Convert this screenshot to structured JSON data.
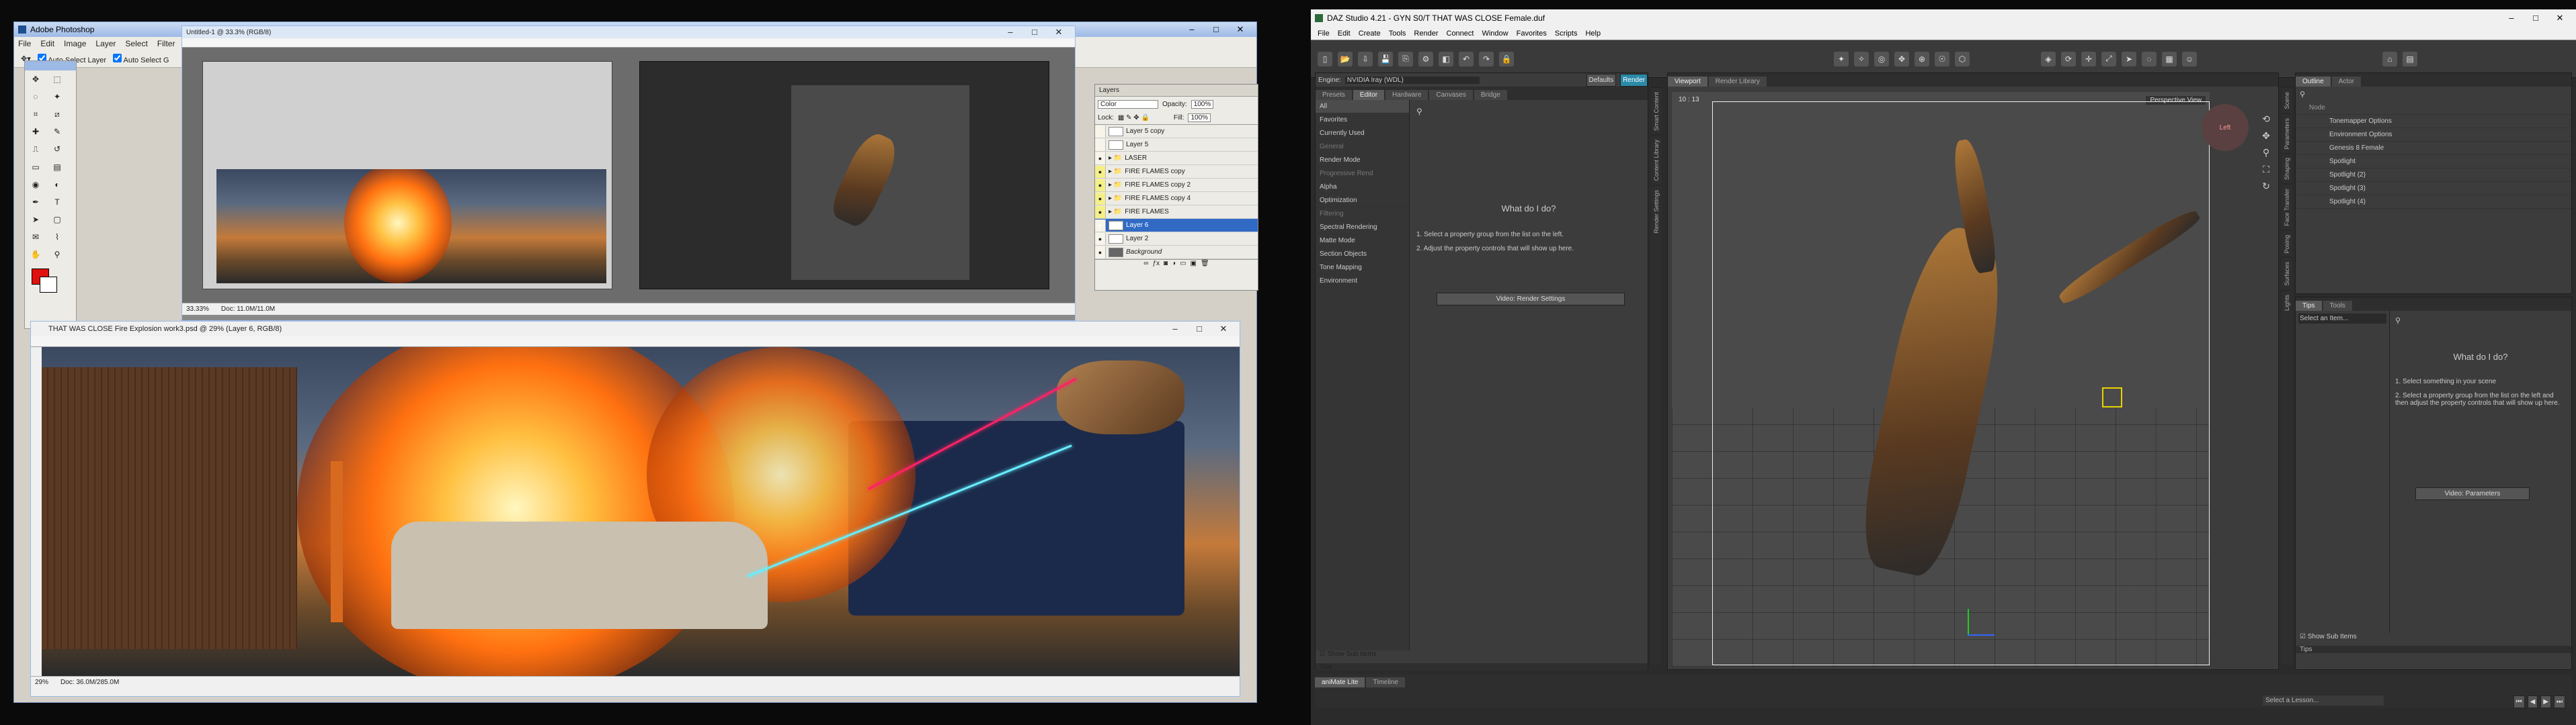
{
  "photoshop": {
    "title": "Adobe Photoshop",
    "menu": [
      "File",
      "Edit",
      "Image",
      "Layer",
      "Select",
      "Filter"
    ],
    "options": {
      "auto_select_layer": "Auto Select Layer",
      "auto_select_2": "Auto Select G"
    },
    "doc_small": {
      "title": "Untitled-1 @ 33.3% (RGB/8)",
      "zoom": "33.33%",
      "docsize": "Doc: 11.0M/11.0M"
    },
    "doc_big": {
      "title": "THAT WAS CLOSE Fire Explosion work3.psd @ 29% (Layer 6, RGB/8)",
      "zoom": "29%",
      "docsize": "Doc: 36.0M/285.0M"
    },
    "layers_panel": {
      "tab": "Layers",
      "blend": "Color",
      "opacity_label": "Opacity:",
      "opacity": "100%",
      "lock_label": "Lock:",
      "fill_label": "Fill:",
      "fill": "100%",
      "rows": [
        "Layer 5 copy",
        "Layer 5",
        "LASER",
        "FIRE FLAMES copy",
        "FIRE FLAMES copy 2",
        "FIRE FLAMES copy 4",
        "FIRE FLAMES",
        "Layer 6",
        "Layer 2",
        "Background"
      ]
    },
    "colors": {
      "fg": "#e01010",
      "bg": "#ffffff"
    }
  },
  "daz": {
    "title": "DAZ Studio 4.21 - GYN S0/T THAT WAS CLOSE Female.duf",
    "menu": [
      "File",
      "Edit",
      "Create",
      "Tools",
      "Render",
      "Connect",
      "Window",
      "Favorites",
      "Scripts",
      "Help"
    ],
    "engine_label": "Engine:",
    "engine": "NVIDIA Iray (WDL)",
    "defaults_btn": "Defaults",
    "render_btn": "Render",
    "render_tabs": [
      "Presets",
      "Editor",
      "Hardware",
      "Canvases",
      "Bridge"
    ],
    "groups": [
      "All",
      "Favorites",
      "Currently Used"
    ],
    "properties": [
      "General",
      "Render Mode",
      "Progressive Rend",
      "Alpha",
      "Optimization",
      "Filtering",
      "Spectral Rendering",
      "Matte Mode",
      "Section Objects",
      "Tone Mapping",
      "Environment"
    ],
    "help_title": "What do I do?",
    "help_steps": [
      "1. Select a property group from the list on the left.",
      "2. Adjust the property controls that will show up here."
    ],
    "video_btn": "Video: Render Settings",
    "show_sub": "Show Sub Items",
    "tips": "Tips",
    "viewport_tabs": [
      "Viewport",
      "Render Library"
    ],
    "perspective": "Perspective View",
    "frame": "10 : 13",
    "scene_tabs": [
      "Outline",
      "Actor"
    ],
    "scene_items": [
      "Node",
      "Tonemapper Options",
      "Environment Options",
      "Genesis 8 Female",
      "Spotlight",
      "Spotlight (2)",
      "Spotlight (3)",
      "Spotlight (4)"
    ],
    "param_tabs": [
      "Tips",
      "Tools"
    ],
    "select_item": "Select an Item...",
    "param_help": "What do I do?",
    "param_steps": [
      "1. Select something in your scene",
      "2. Select a property group from the list on the left and then adjust the property controls that will show up here."
    ],
    "param_video": "Video: Parameters",
    "bottom_tabs": [
      "aniMate Lite",
      "Timeline"
    ],
    "lesson": "Select a Lesson..."
  }
}
